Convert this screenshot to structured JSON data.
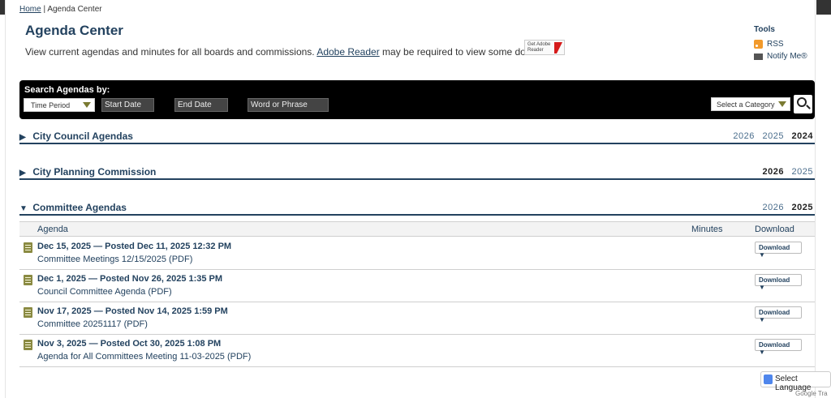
{
  "breadcrumb": {
    "home": "Home",
    "separator": "|",
    "current": "Agenda Center"
  },
  "page": {
    "title": "Agenda Center",
    "intro_prefix": "View current agendas and minutes for all boards and commissions.",
    "intro_link": "Adobe Reader",
    "intro_suffix": "may be required to view some documents.",
    "adobe_badge": "Get Adobe Reader"
  },
  "tools": {
    "heading": "Tools",
    "rss": "RSS",
    "notify": "Notify Me®"
  },
  "search": {
    "label": "Search Agendas by:",
    "time_period": "Time Period",
    "start_date": "Start Date",
    "end_date": "End Date",
    "word_or_phrase": "Word or Phrase",
    "category": "Select a Category"
  },
  "sections": [
    {
      "name": "City Council Agendas",
      "arrow": "▶",
      "years": [
        "2026",
        "2025",
        "2024"
      ],
      "current_year": "2024"
    },
    {
      "name": "City Planning Commission",
      "arrow": "▶",
      "years": [
        "2026",
        "2025"
      ],
      "current_year": "2026"
    },
    {
      "name": "Committee Agendas",
      "arrow": "▼",
      "years": [
        "2026",
        "2025"
      ],
      "current_year": "2025"
    }
  ],
  "table": {
    "headers": {
      "agenda": "Agenda",
      "minutes": "Minutes",
      "download": "Download"
    },
    "rows": [
      {
        "when": "Dec 15, 2025  — Posted Dec 11, 2025 12:32 PM",
        "file": "Committee Meetings 12/15/2025 (PDF)",
        "download": "Download ▼"
      },
      {
        "when": "Dec 1, 2025  — Posted Nov 26, 2025 1:35 PM",
        "file": "Council Committee Agenda (PDF)",
        "download": "Download ▼"
      },
      {
        "when": "Nov 17, 2025  — Posted Nov 14, 2025 1:59 PM",
        "file": "Committee 20251117 (PDF)",
        "download": "Download ▼"
      },
      {
        "when": "Nov 3, 2025  — Posted Oct 30, 2025 1:08 PM",
        "file": "Agenda for All Committees Meeting 11-03-2025 (PDF)",
        "download": "Download ▼"
      }
    ]
  },
  "translate": {
    "label": "Select Language",
    "powered_google": "Google",
    "powered_rest": "Tra"
  },
  "colors": {
    "brand_blue": "#23425f",
    "doc_icon": "#8a8a42",
    "rss": "#f29a2b"
  }
}
